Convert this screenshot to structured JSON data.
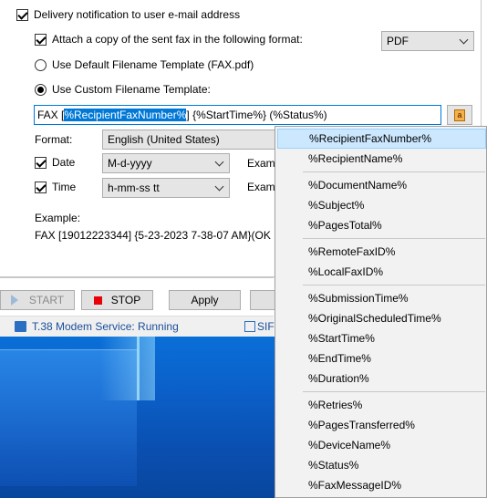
{
  "delivery": {
    "notify_label": "Delivery notification to user e-mail address",
    "notify_checked": true,
    "attach_label": "Attach a copy of the sent fax in the following format:",
    "attach_checked": true,
    "format_value": "PDF",
    "default_template_label": "Use Default Filename Template (FAX.pdf)",
    "custom_template_label": "Use Custom Filename Template:",
    "custom_selected": true
  },
  "template": {
    "prefix": "FAX [",
    "selected": "%RecipientFaxNumber%",
    "suffix": "] {%StartTime%} (%Status%)"
  },
  "format_row": {
    "label": "Format:",
    "value": "English (United States)"
  },
  "date_row": {
    "label": "Date",
    "checked": true,
    "value": "M-d-yyyy",
    "example_label": "Examp"
  },
  "time_row": {
    "label": "Time",
    "checked": true,
    "value": "h-mm-ss tt",
    "example_label": "Examp"
  },
  "example": {
    "label": "Example:",
    "value": "FAX [19012223344] {5-23-2023 7-38-07 AM}(OK"
  },
  "buttons": {
    "start": "START",
    "stop": "STOP",
    "apply": "Apply"
  },
  "status": {
    "modem": "T.38 Modem Service: Running",
    "sip": "SIF"
  },
  "menu": {
    "groups": [
      [
        "%RecipientFaxNumber%",
        "%RecipientName%"
      ],
      [
        "%DocumentName%",
        "%Subject%",
        "%PagesTotal%"
      ],
      [
        "%RemoteFaxID%",
        "%LocalFaxID%"
      ],
      [
        "%SubmissionTime%",
        "%OriginalScheduledTime%",
        "%StartTime%",
        "%EndTime%",
        "%Duration%"
      ],
      [
        "%Retries%",
        "%PagesTransferred%",
        "%DeviceName%",
        "%Status%",
        "%FaxMessageID%"
      ]
    ],
    "highlighted": "%RecipientFaxNumber%"
  },
  "colors": {
    "accent": "#0078d7",
    "menu_highlight": "#cce8ff",
    "stop_red": "#e8000b",
    "desktop_blue": "#0a5fc8"
  }
}
